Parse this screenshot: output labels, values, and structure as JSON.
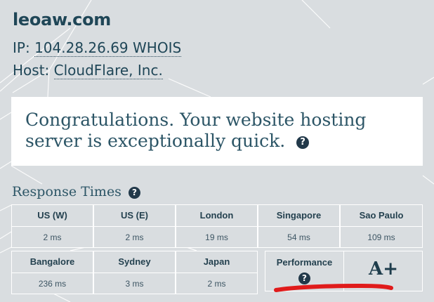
{
  "site": {
    "domain": "leoaw.com",
    "ip_label": "IP:",
    "ip": "104.28.26.69",
    "whois": "WHOIS",
    "host_label": "Host:",
    "host": "CloudFlare, Inc."
  },
  "banner": {
    "message_line1": "Congratulations. Your website hosting",
    "message_line2": "server is exceptionally quick.",
    "help_icon": "?"
  },
  "response_times": {
    "title": "Response Times",
    "help_icon": "?",
    "locations": [
      {
        "name": "US (W)",
        "value": "2 ms"
      },
      {
        "name": "US (E)",
        "value": "2 ms"
      },
      {
        "name": "London",
        "value": "19 ms"
      },
      {
        "name": "Singapore",
        "value": "54 ms"
      },
      {
        "name": "Sao Paulo",
        "value": "109 ms"
      },
      {
        "name": "Bangalore",
        "value": "236 ms"
      },
      {
        "name": "Sydney",
        "value": "3 ms"
      },
      {
        "name": "Japan",
        "value": "2 ms"
      }
    ]
  },
  "performance": {
    "label": "Performance",
    "help_icon": "?",
    "grade": "A+"
  },
  "colors": {
    "background": "#d9dde0",
    "text": "#1f4657",
    "annotation": "#e01b1b"
  }
}
